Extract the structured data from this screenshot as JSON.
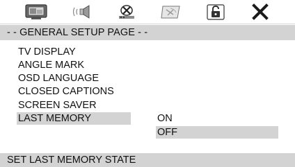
{
  "toolbar": {
    "icons": [
      {
        "name": "general-setup-icon"
      },
      {
        "name": "audio-setup-icon"
      },
      {
        "name": "dolby-digital-icon"
      },
      {
        "name": "video-setup-icon"
      },
      {
        "name": "preference-lock-icon"
      },
      {
        "name": "exit-icon"
      }
    ]
  },
  "header": {
    "title": "- - GENERAL SETUP PAGE - -"
  },
  "menu": {
    "items": [
      {
        "label": "TV DISPLAY"
      },
      {
        "label": "ANGLE MARK"
      },
      {
        "label": "OSD LANGUAGE"
      },
      {
        "label": "CLOSED CAPTIONS"
      },
      {
        "label": "SCREEN SAVER"
      },
      {
        "label": "LAST MEMORY",
        "selected": true
      }
    ]
  },
  "options": {
    "items": [
      {
        "label": "ON"
      },
      {
        "label": "OFF",
        "highlighted": true
      }
    ]
  },
  "status": {
    "text": "SET LAST MEMORY STATE"
  },
  "colors": {
    "highlight": "#d3d3d3",
    "text": "#111111",
    "background": "#ffffff"
  }
}
